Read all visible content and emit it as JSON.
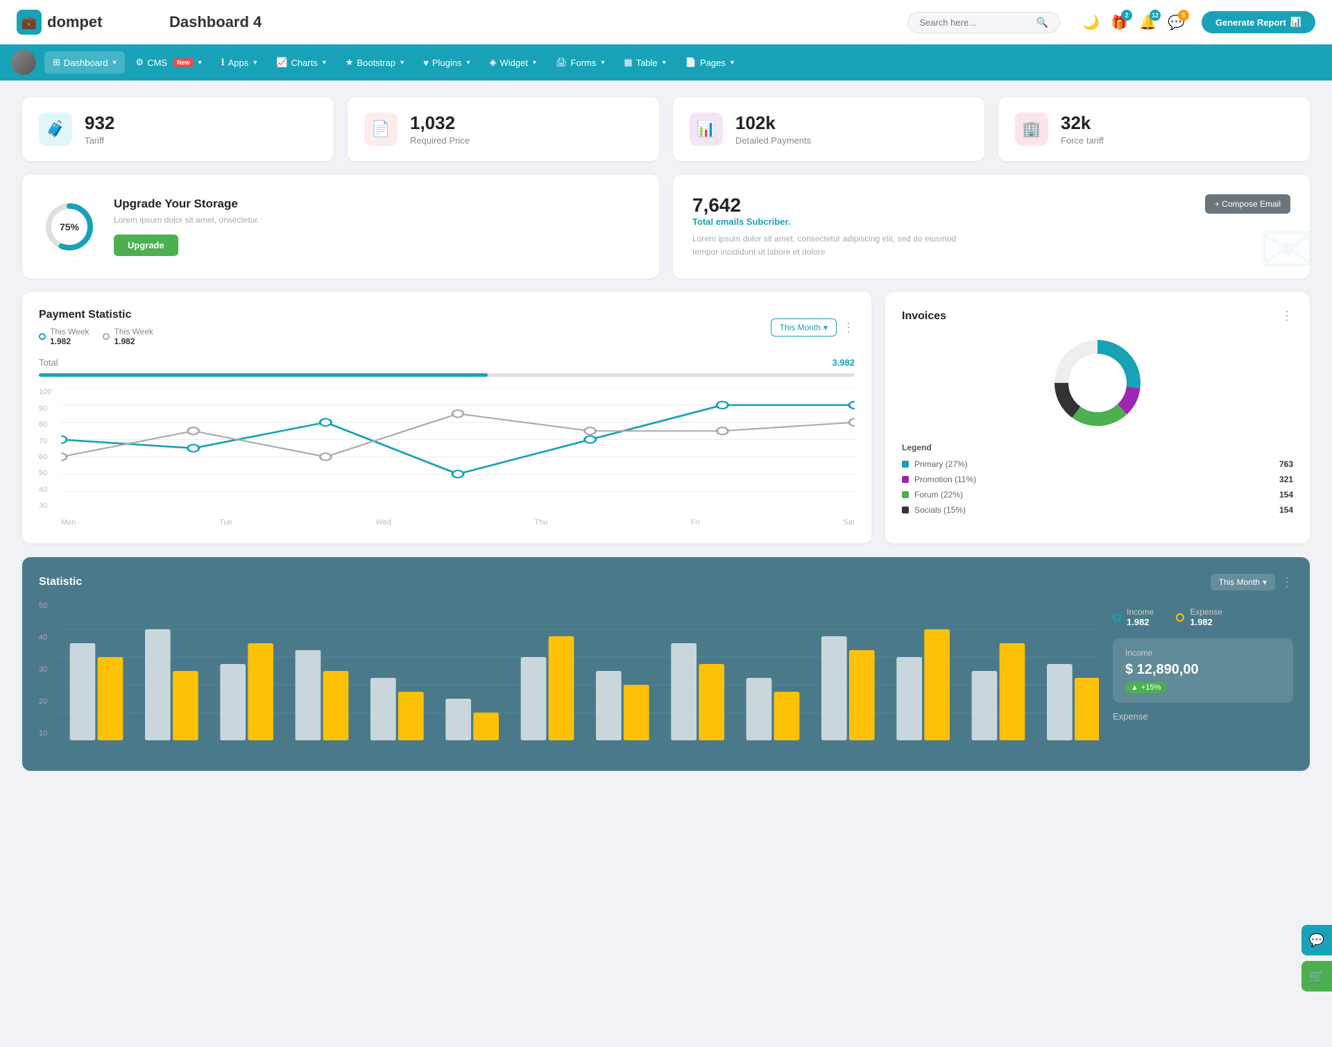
{
  "header": {
    "logo_text": "dompet",
    "title": "Dashboard 4",
    "search_placeholder": "Search here...",
    "generate_btn": "Generate Report",
    "icons": {
      "gift_badge": "2",
      "bell_badge": "12",
      "chat_badge": "5"
    }
  },
  "navbar": {
    "items": [
      {
        "label": "Dashboard",
        "icon": "grid",
        "active": true,
        "has_arrow": true
      },
      {
        "label": "CMS",
        "icon": "gear",
        "active": false,
        "has_arrow": true,
        "badge": "New"
      },
      {
        "label": "Apps",
        "icon": "info",
        "active": false,
        "has_arrow": true
      },
      {
        "label": "Charts",
        "icon": "chart",
        "active": false,
        "has_arrow": true
      },
      {
        "label": "Bootstrap",
        "icon": "star",
        "active": false,
        "has_arrow": true
      },
      {
        "label": "Plugins",
        "icon": "heart",
        "active": false,
        "has_arrow": true
      },
      {
        "label": "Widget",
        "icon": "widget",
        "active": false,
        "has_arrow": true
      },
      {
        "label": "Forms",
        "icon": "form",
        "active": false,
        "has_arrow": true
      },
      {
        "label": "Table",
        "icon": "table",
        "active": false,
        "has_arrow": true
      },
      {
        "label": "Pages",
        "icon": "pages",
        "active": false,
        "has_arrow": true
      }
    ]
  },
  "stat_cards": [
    {
      "value": "932",
      "label": "Tariff",
      "icon": "briefcase",
      "icon_class": "stat-icon-teal"
    },
    {
      "value": "1,032",
      "label": "Required Price",
      "icon": "file",
      "icon_class": "stat-icon-red"
    },
    {
      "value": "102k",
      "label": "Detailed Payments",
      "icon": "bar",
      "icon_class": "stat-icon-purple"
    },
    {
      "value": "32k",
      "label": "Force tariff",
      "icon": "building",
      "icon_class": "stat-icon-pink"
    }
  ],
  "storage": {
    "percent": "75%",
    "title": "Upgrade Your Storage",
    "desc": "Lorem ipsum dolor sit amet, onsectetur.",
    "btn": "Upgrade"
  },
  "email": {
    "count": "7,642",
    "subtitle": "Total emails Subcriber.",
    "desc": "Lorem ipsum dolor sit amet, consectetur adipiscing elit, sed do eiusmod tempor incididunt ut labore et dolore",
    "compose_btn": "+ Compose Email"
  },
  "payment": {
    "title": "Payment Statistic",
    "legend1_label": "This Week",
    "legend1_value": "1.982",
    "legend2_label": "This Week",
    "legend2_value": "1.982",
    "filter_btn": "This Month",
    "total_label": "Total",
    "total_value": "3.982",
    "x_labels": [
      "Mon",
      "Tue",
      "Wed",
      "Thu",
      "Fri",
      "Sat"
    ],
    "y_labels": [
      "100",
      "90",
      "80",
      "70",
      "60",
      "50",
      "40",
      "30"
    ],
    "line1_points": "0,60 120,50 240,80 360,40 480,60 600,90 720,90",
    "line2_points": "0,40 120,70 240,50 360,80 480,65 600,65 720,85"
  },
  "invoices": {
    "title": "Invoices",
    "legend": [
      {
        "label": "Primary (27%)",
        "color_class": "legend-sq-teal",
        "count": "763"
      },
      {
        "label": "Promotion (11%)",
        "color_class": "legend-sq-purple",
        "count": "321"
      },
      {
        "label": "Forum (22%)",
        "color_class": "legend-sq-green",
        "count": "154"
      },
      {
        "label": "Socials (15%)",
        "color_class": "legend-sq-dark",
        "count": "154"
      }
    ],
    "legend_title": "Legend"
  },
  "statistic": {
    "title": "Statistic",
    "filter_btn": "This Month",
    "income_label": "Income",
    "income_value": "1.982",
    "expense_label": "Expense",
    "expense_value": "1.982",
    "y_labels": [
      "50",
      "40",
      "30",
      "20",
      "10"
    ],
    "income_panel": {
      "title": "Income",
      "amount": "$ 12,890,00",
      "badge": "+15%"
    },
    "expense_label2": "Expense"
  }
}
